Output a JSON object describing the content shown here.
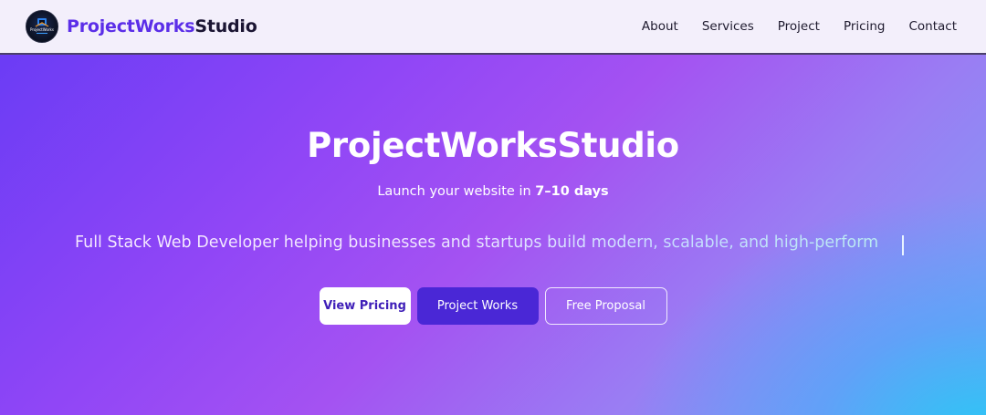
{
  "brand": {
    "name_part1": "ProjectWorks",
    "name_part2": "Studio",
    "logo_text": "ProjectWorks"
  },
  "nav": {
    "items": [
      {
        "label": "About"
      },
      {
        "label": "Services"
      },
      {
        "label": "Project"
      },
      {
        "label": "Pricing"
      },
      {
        "label": "Contact"
      }
    ]
  },
  "hero": {
    "title": "ProjectWorksStudio",
    "subtitle_prefix": "Launch your website in ",
    "subtitle_highlight": "7–10 days",
    "tagline": "Full Stack Web Developer helping businesses and startups build modern, scalable, and high-perform"
  },
  "buttons": {
    "view_pricing": "View Pricing",
    "project_works": "Project Works",
    "free_proposal": "Free Proposal"
  },
  "colors": {
    "accent": "#5b2ee8",
    "nav_bg": "#f3effb",
    "primary_button": "#4a27d6",
    "gradient_start": "#6b3cf5",
    "gradient_end": "#28c8f5"
  }
}
